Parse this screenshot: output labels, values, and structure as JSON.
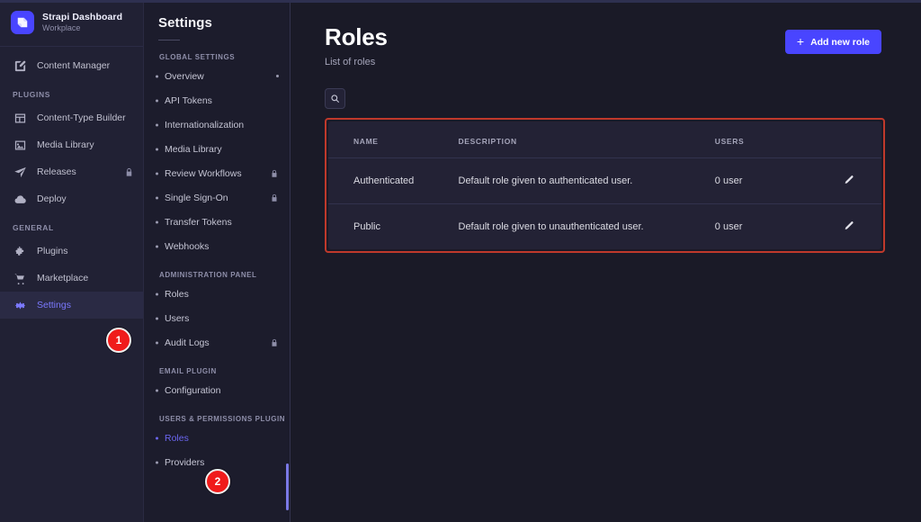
{
  "brand": {
    "title": "Strapi Dashboard",
    "subtitle": "Workplace",
    "logo_icon": "strapi-logo-icon",
    "accent_color": "#4945ff"
  },
  "mainnav": {
    "top_items": [
      {
        "label": "Content Manager",
        "icon": "pencil-square-icon",
        "active": false,
        "locked": false
      }
    ],
    "sections": [
      {
        "label": "PLUGINS",
        "items": [
          {
            "label": "Content-Type Builder",
            "icon": "layout-icon",
            "active": false,
            "locked": false
          },
          {
            "label": "Media Library",
            "icon": "image-icon",
            "active": false,
            "locked": false
          },
          {
            "label": "Releases",
            "icon": "paper-plane-icon",
            "active": false,
            "locked": true
          },
          {
            "label": "Deploy",
            "icon": "cloud-icon",
            "active": false,
            "locked": false
          }
        ]
      },
      {
        "label": "GENERAL",
        "items": [
          {
            "label": "Plugins",
            "icon": "puzzle-icon",
            "active": false,
            "locked": false
          },
          {
            "label": "Marketplace",
            "icon": "cart-icon",
            "active": false,
            "locked": false
          },
          {
            "label": "Settings",
            "icon": "gear-icon",
            "active": true,
            "locked": false
          }
        ]
      }
    ]
  },
  "subnav": {
    "title": "Settings",
    "sections": [
      {
        "label": "GLOBAL SETTINGS",
        "items": [
          {
            "label": "Overview",
            "active": false,
            "locked": false,
            "dot": true
          },
          {
            "label": "API Tokens",
            "active": false,
            "locked": false,
            "dot": false
          },
          {
            "label": "Internationalization",
            "active": false,
            "locked": false,
            "dot": false
          },
          {
            "label": "Media Library",
            "active": false,
            "locked": false,
            "dot": false
          },
          {
            "label": "Review Workflows",
            "active": false,
            "locked": true,
            "dot": false
          },
          {
            "label": "Single Sign-On",
            "active": false,
            "locked": true,
            "dot": false
          },
          {
            "label": "Transfer Tokens",
            "active": false,
            "locked": false,
            "dot": false
          },
          {
            "label": "Webhooks",
            "active": false,
            "locked": false,
            "dot": false
          }
        ]
      },
      {
        "label": "ADMINISTRATION PANEL",
        "items": [
          {
            "label": "Roles",
            "active": false,
            "locked": false,
            "dot": false
          },
          {
            "label": "Users",
            "active": false,
            "locked": false,
            "dot": false
          },
          {
            "label": "Audit Logs",
            "active": false,
            "locked": true,
            "dot": false
          }
        ]
      },
      {
        "label": "EMAIL PLUGIN",
        "items": [
          {
            "label": "Configuration",
            "active": false,
            "locked": false,
            "dot": false
          }
        ]
      },
      {
        "label": "USERS & PERMISSIONS PLUGIN",
        "items": [
          {
            "label": "Roles",
            "active": true,
            "locked": false,
            "dot": false
          },
          {
            "label": "Providers",
            "active": false,
            "locked": false,
            "dot": false
          }
        ]
      }
    ]
  },
  "main": {
    "title": "Roles",
    "subtitle": "List of roles",
    "add_button": {
      "label": "Add new role",
      "icon": "plus-icon"
    },
    "search": {
      "icon": "search-icon",
      "label": "Search"
    },
    "table": {
      "columns": [
        "NAME",
        "DESCRIPTION",
        "USERS",
        ""
      ],
      "rows": [
        {
          "name": "Authenticated",
          "description": "Default role given to authenticated user.",
          "users": "0 user",
          "action_icon": "pencil-icon"
        },
        {
          "name": "Public",
          "description": "Default role given to unauthenticated user.",
          "users": "0 user",
          "action_icon": "pencil-icon"
        }
      ],
      "highlight_color": "#c0392b"
    }
  },
  "annotations": {
    "badges": [
      {
        "number": "1",
        "target": "Settings"
      },
      {
        "number": "2",
        "target": "Roles"
      }
    ],
    "badge_color": "#f01b1b"
  }
}
